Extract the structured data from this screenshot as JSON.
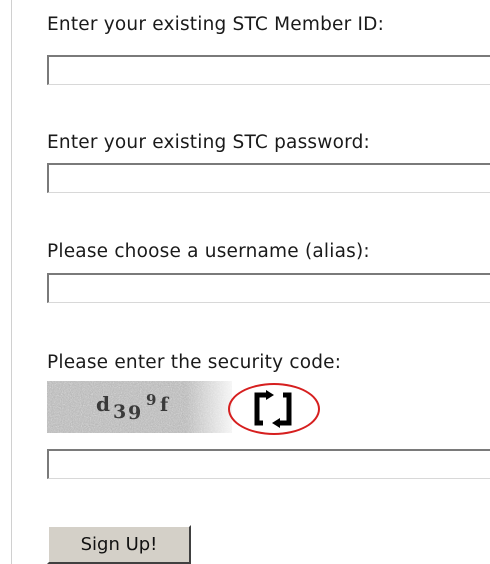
{
  "form": {
    "member_id_label": "Enter your existing STC Member ID:",
    "member_id_value": "",
    "password_label": "Enter your existing STC password:",
    "password_value": "",
    "username_label": "Please choose a username (alias):",
    "username_value": "",
    "security_label": "Please enter the security code:",
    "security_value": "",
    "captcha_text": "d39ᶠ",
    "refresh_icon": "refresh-icon",
    "submit_label": "Sign Up!"
  },
  "colors": {
    "highlight_ring": "#d61f1f",
    "button_face": "#d4d0c8",
    "text": "#1a1a1a"
  }
}
